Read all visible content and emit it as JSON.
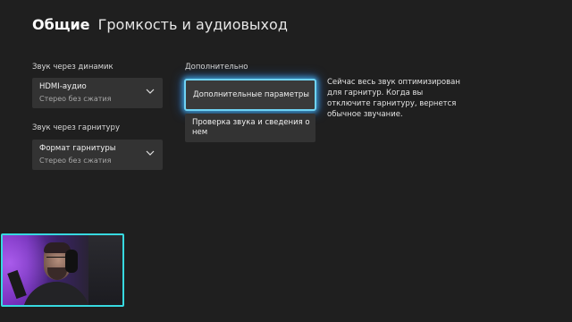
{
  "header": {
    "section": "Общие",
    "page": "Громкость и аудиовыход"
  },
  "speaker": {
    "label": "Звук через динамик",
    "value": "HDMI-аудио",
    "sub": "Стерео без сжатия"
  },
  "headset": {
    "label": "Звук через гарнитуру",
    "value": "Формат гарнитуры",
    "sub": "Стерео без сжатия"
  },
  "additional": {
    "label": "Дополнительно",
    "advanced_button": "Дополнительные параметры",
    "check_button": "Проверка звука и сведения о нем"
  },
  "info_text": "Сейчас весь звук оптимизирован для гарнитур. Когда вы отключите гарнитуру, вернется обычное звучание.",
  "icons": {
    "dropdown": "chevron-down-icon"
  },
  "colors": {
    "focus": "#6fd3f4",
    "webcam_border": "#37d9e0",
    "background": "#1f1f1f"
  }
}
